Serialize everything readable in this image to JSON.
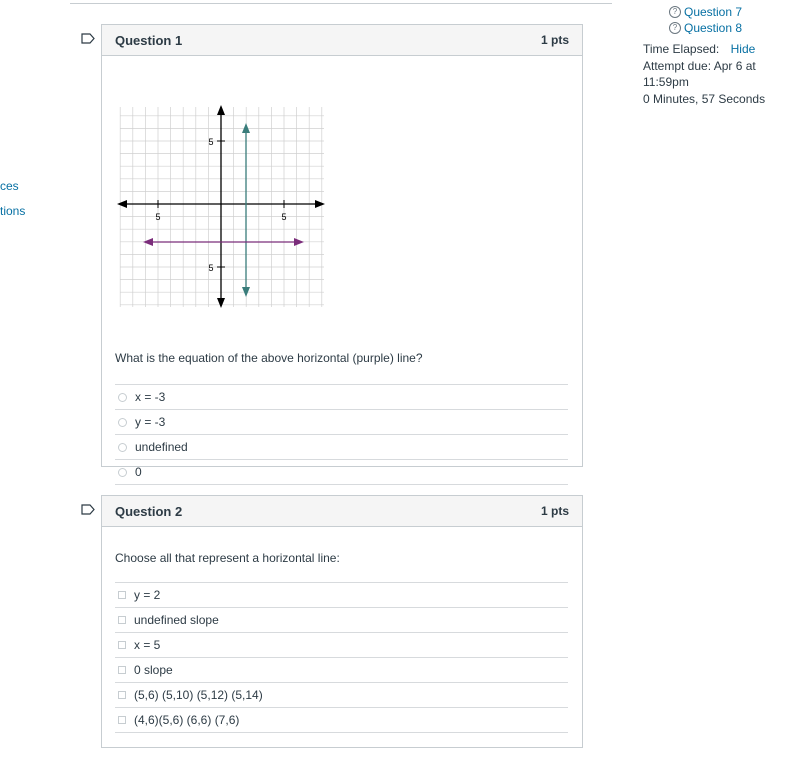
{
  "left_nav": [
    "ces",
    "tions"
  ],
  "sidebar": {
    "question_links": [
      "Question 7",
      "Question 8"
    ],
    "time_elapsed_label": "Time Elapsed:",
    "hide_label": "Hide",
    "attempt_due_line1": "Attempt due: Apr 6 at",
    "attempt_due_line2": "11:59pm",
    "elapsed_value": "0 Minutes, 57 Seconds"
  },
  "questions": [
    {
      "title": "Question 1",
      "points": "1 pts",
      "text": "What is the equation of the above horizontal (purple) line?",
      "answers": [
        "x = -3",
        "y = -3",
        "undefined",
        "0"
      ]
    },
    {
      "title": "Question 2",
      "points": "1 pts",
      "text": "Choose all that represent a horizontal line:",
      "answers": [
        "y = 2",
        "undefined slope",
        "x = 5",
        "0 slope",
        "(5,6) (5,10) (5,12) (5,14)",
        "(4,6)(5,6) (6,6) (7,6)"
      ]
    }
  ],
  "graph": {
    "tick_labels": {
      "y_top": "5",
      "y_bottom": "5",
      "x_left": "5",
      "x_right": "5"
    },
    "colors": {
      "axis": "#000000",
      "vertical_line": "#3a7d7b",
      "horizontal_line": "#7b2d7b",
      "grid": "#d0d0d0"
    }
  }
}
